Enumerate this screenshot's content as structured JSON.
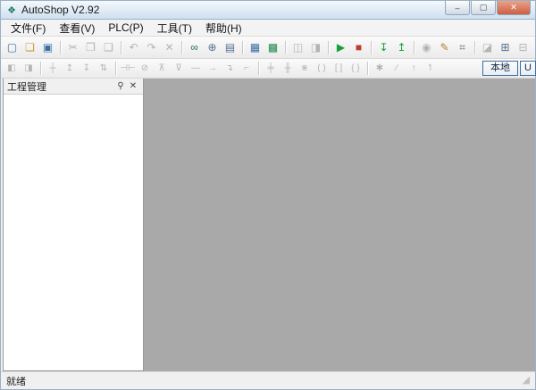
{
  "colors": {
    "accent": "#3a6ea5",
    "border": "#9ab0c6",
    "chrome": "#f0f0f0",
    "titlebar_top": "#f4f8fc",
    "titlebar_bottom": "#cfe0ef",
    "workspace": "#a9a9a9",
    "close_red": "#cf5f42"
  },
  "window": {
    "title": "AutoShop V2.92",
    "app_icon_glyph": "❖",
    "caption": {
      "minimize": "–",
      "maximize": "▢",
      "close": "✕"
    }
  },
  "menu": {
    "items": [
      {
        "name": "menu-file",
        "label": "文件(F)"
      },
      {
        "name": "menu-view",
        "label": "查看(V)"
      },
      {
        "name": "menu-plc",
        "label": "PLC(P)"
      },
      {
        "name": "menu-tools",
        "label": "工具(T)"
      },
      {
        "name": "menu-help",
        "label": "帮助(H)"
      }
    ]
  },
  "toolbar1": {
    "items": [
      {
        "name": "new-file-button",
        "glyph": "▢",
        "color": "#3a6ea5"
      },
      {
        "name": "open-project-button",
        "glyph": "❏",
        "color": "#c89b3c"
      },
      {
        "name": "save-button",
        "glyph": "▣",
        "color": "#3a6ea5"
      },
      {
        "sep": true
      },
      {
        "name": "cut-button",
        "glyph": "✂",
        "enabled": false
      },
      {
        "name": "copy-button",
        "glyph": "❐",
        "enabled": false
      },
      {
        "name": "paste-button",
        "glyph": "❑",
        "enabled": false
      },
      {
        "sep": true
      },
      {
        "name": "undo-button",
        "glyph": "↶",
        "enabled": false
      },
      {
        "name": "redo-button",
        "glyph": "↷",
        "enabled": false
      },
      {
        "name": "delete-button",
        "glyph": "✕",
        "enabled": false
      },
      {
        "sep": true
      },
      {
        "name": "find-button",
        "glyph": "∞",
        "color": "#1e6b46"
      },
      {
        "name": "zoom-button",
        "glyph": "⊕",
        "color": "#55708c"
      },
      {
        "name": "print-button",
        "glyph": "▤",
        "color": "#55708c"
      },
      {
        "sep": true
      },
      {
        "name": "ladder-view-button",
        "glyph": "▦",
        "color": "#3a6ea5"
      },
      {
        "name": "instruction-view-button",
        "glyph": "▩",
        "color": "#1e8a4a"
      },
      {
        "sep": true
      },
      {
        "name": "window-tile-button",
        "glyph": "◫",
        "enabled": false
      },
      {
        "name": "window-cascade-button",
        "glyph": "◨",
        "enabled": false
      },
      {
        "sep": true
      },
      {
        "name": "run-button",
        "glyph": "▶",
        "color": "#18a038"
      },
      {
        "name": "stop-button",
        "glyph": "■",
        "color": "#c23a2b"
      },
      {
        "sep": true
      },
      {
        "name": "download-button",
        "glyph": "↧",
        "color": "#18a038"
      },
      {
        "name": "upload-button",
        "glyph": "↥",
        "color": "#18a038"
      },
      {
        "sep": true
      },
      {
        "name": "monitor-button",
        "glyph": "◉",
        "enabled": false
      },
      {
        "name": "edit-tool-button",
        "glyph": "✎",
        "color": "#b08030"
      },
      {
        "name": "check-button",
        "glyph": "⌗",
        "color": "#55708c"
      },
      {
        "sep": true
      },
      {
        "name": "option-a-button",
        "glyph": "◪",
        "enabled": false
      },
      {
        "name": "option-b-button",
        "glyph": "⊞",
        "color": "#55708c"
      },
      {
        "name": "option-c-button",
        "glyph": "⊟",
        "enabled": false
      }
    ]
  },
  "toolbar2": {
    "items": [
      {
        "name": "network-add-button",
        "glyph": "◧",
        "enabled": false
      },
      {
        "name": "network-delete-button",
        "glyph": "◨",
        "enabled": false
      },
      {
        "sep": true
      },
      {
        "name": "cross-line-button",
        "glyph": "┼",
        "enabled": false
      },
      {
        "name": "line-up-button",
        "glyph": "↥",
        "enabled": false
      },
      {
        "name": "line-down-button",
        "glyph": "↧",
        "enabled": false
      },
      {
        "name": "line-updown-button",
        "glyph": "⇅",
        "enabled": false
      },
      {
        "sep": true
      },
      {
        "name": "contact-no-button",
        "glyph": "⊣⊢",
        "enabled": false
      },
      {
        "name": "contact-nc-button",
        "glyph": "⊘",
        "enabled": false
      },
      {
        "name": "contact-rising-button",
        "glyph": "⊼",
        "enabled": false
      },
      {
        "name": "contact-falling-button",
        "glyph": "⊽",
        "enabled": false
      },
      {
        "name": "h-line-button",
        "glyph": "—",
        "enabled": false
      },
      {
        "name": "arrow-right-button",
        "glyph": "→",
        "enabled": false
      },
      {
        "name": "corner-down-button",
        "glyph": "↴",
        "enabled": false
      },
      {
        "name": "corner-up-button",
        "glyph": "⌐",
        "enabled": false
      },
      {
        "sep": true
      },
      {
        "name": "compare-a-button",
        "glyph": "╪",
        "enabled": false
      },
      {
        "name": "compare-b-button",
        "glyph": "╫",
        "enabled": false
      },
      {
        "name": "star-contact-button",
        "glyph": "⋇",
        "enabled": false
      },
      {
        "name": "coil-button",
        "glyph": "( )",
        "enabled": false
      },
      {
        "name": "bracket-button",
        "glyph": "[ ]",
        "enabled": false
      },
      {
        "name": "brace-button",
        "glyph": "{ }",
        "enabled": false
      },
      {
        "sep": true
      },
      {
        "name": "star-button",
        "glyph": "✱",
        "enabled": false
      },
      {
        "name": "slash-button",
        "glyph": "∕",
        "enabled": false
      },
      {
        "name": "arrow-up-button",
        "glyph": "↑",
        "enabled": false
      },
      {
        "name": "arrow-up2-button",
        "glyph": "↿",
        "enabled": false
      }
    ],
    "local_button_label": "本地",
    "partial_button_label": "U"
  },
  "project_panel": {
    "title": "工程管理",
    "pin_glyph": "⚲",
    "close_glyph": "✕"
  },
  "statusbar": {
    "text": "就绪",
    "grip_glyph": "◢"
  }
}
